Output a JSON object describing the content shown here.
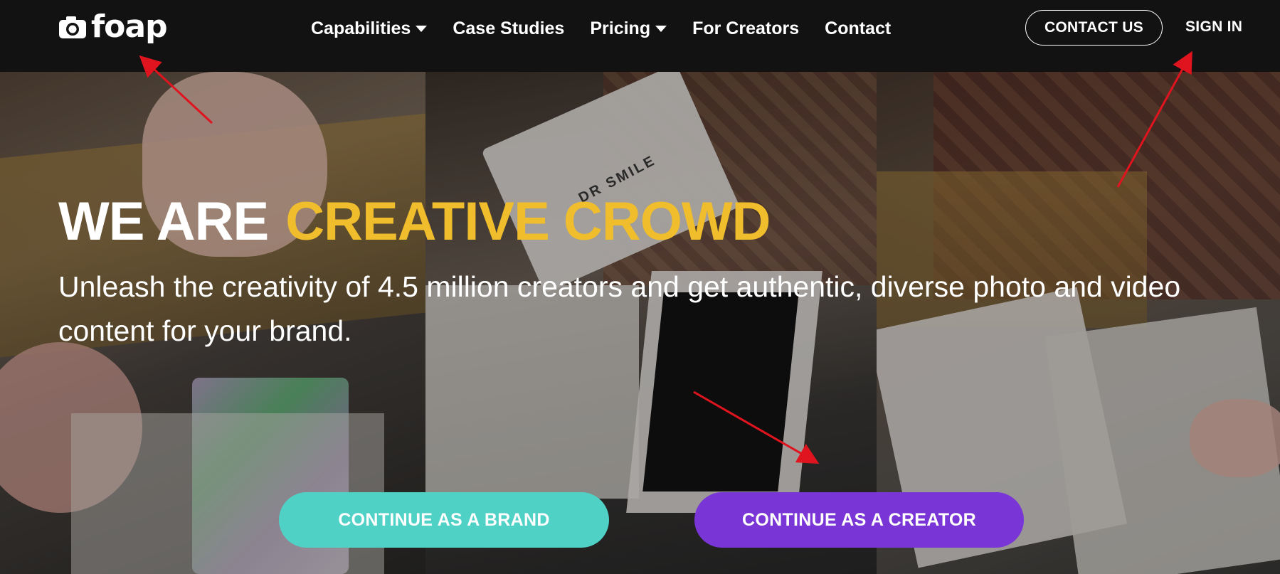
{
  "nav": {
    "logo_text": "foap",
    "links": [
      {
        "label": "Capabilities",
        "dropdown": true
      },
      {
        "label": "Case Studies",
        "dropdown": false
      },
      {
        "label": "Pricing",
        "dropdown": true
      },
      {
        "label": "For Creators",
        "dropdown": false
      },
      {
        "label": "Contact",
        "dropdown": false
      }
    ],
    "contact_button": "CONTACT US",
    "sign_in": "SIGN IN"
  },
  "hero": {
    "headline_white": "WE ARE",
    "headline_accent": "CREATIVE CROWD",
    "subtitle": "Unleash the creativity of 4.5 million creators and get authentic, diverse photo and video content for your brand.",
    "brand_button": "CONTINUE AS A BRAND",
    "creator_button": "CONTINUE AS A CREATOR",
    "package_text": "DR SMILE"
  },
  "colors": {
    "nav_bg": "#121212",
    "accent_yellow": "#f0bd2c",
    "brand_teal": "#4fd1c5",
    "creator_purple": "#7a35d6",
    "annotation_arrow": "#e0141e"
  }
}
